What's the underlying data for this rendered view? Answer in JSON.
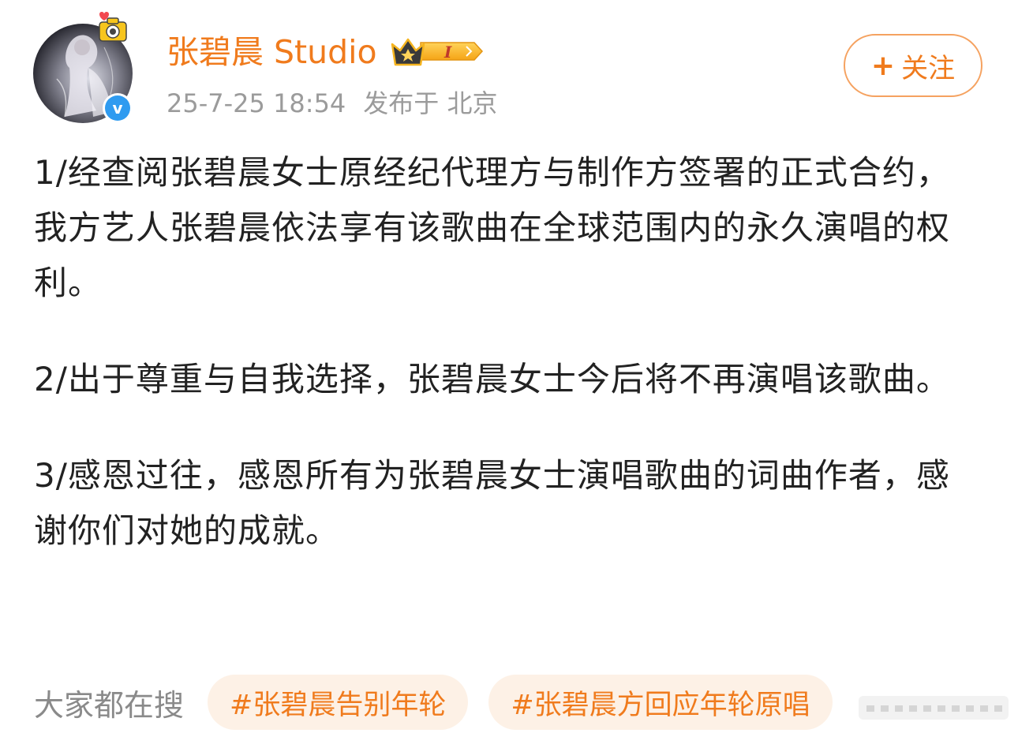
{
  "post": {
    "author": "张碧晨 Studio",
    "member_level": "I",
    "date": "25-7-25 18:54",
    "location": "发布于 北京",
    "follow_label": "关注",
    "follow_plus": "+",
    "verified_mark": "v",
    "paragraphs": [
      "1/经查阅张碧晨女士原经纪代理方与制作方签署的正式合约，我方艺人张碧晨依法享有该歌曲在全球范围内的永久演唱的权利。",
      "2/出于尊重与自我选择，张碧晨女士今后将不再演唱该歌曲。",
      "3/感恩过往，感恩所有为张碧晨女士演唱歌曲的词曲作者，感谢你们对她的成就。"
    ]
  },
  "hot_search": {
    "label": "大家都在搜",
    "tags": [
      "#张碧晨告别年轮",
      "#张碧晨方回应年轮原唱"
    ]
  },
  "colors": {
    "accent": "#f07b1d",
    "verified": "#2f9bf0",
    "tag_background": "#fdf1e6",
    "meta_text": "#9b9b9b"
  },
  "icons": {
    "avatar": "avatar-image",
    "verified": "verified-icon",
    "member_badge": "crown-badge-icon",
    "camera": "camera-sticker-icon",
    "more": "more-icon"
  }
}
